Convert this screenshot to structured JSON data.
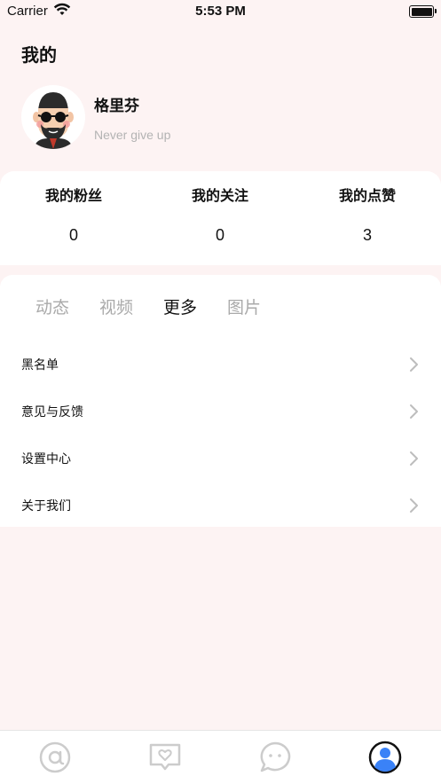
{
  "status_bar": {
    "carrier": "Carrier",
    "time": "5:53 PM"
  },
  "page": {
    "title": "我的"
  },
  "profile": {
    "name": "格里芬",
    "motto": "Never give up"
  },
  "stats": [
    {
      "label": "我的粉丝",
      "value": "0"
    },
    {
      "label": "我的关注",
      "value": "0"
    },
    {
      "label": "我的点赞",
      "value": "3"
    }
  ],
  "tabs": [
    {
      "label": "动态",
      "active": false
    },
    {
      "label": "视频",
      "active": false
    },
    {
      "label": "更多",
      "active": true
    },
    {
      "label": "图片",
      "active": false
    }
  ],
  "menu": [
    {
      "label": "黑名单"
    },
    {
      "label": "意见与反馈"
    },
    {
      "label": "设置中心"
    },
    {
      "label": "关于我们"
    }
  ],
  "tab_bar": {
    "items": [
      {
        "icon": "at-sign-icon",
        "active": false
      },
      {
        "icon": "heart-message-icon",
        "active": false
      },
      {
        "icon": "chat-bubble-icon",
        "active": false
      },
      {
        "icon": "profile-icon",
        "active": true
      }
    ],
    "accent_color": "#3a82f7",
    "inactive_color": "#cccccc"
  },
  "colors": {
    "background": "#fdf3f3",
    "card": "#ffffff",
    "muted_text": "#b3b3b3"
  }
}
